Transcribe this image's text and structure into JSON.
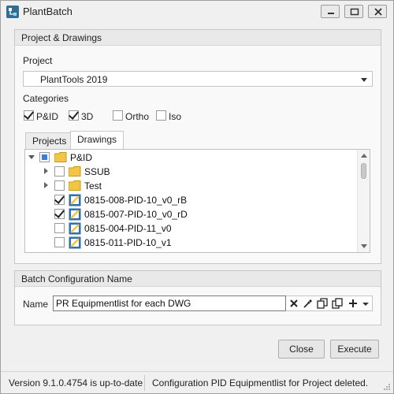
{
  "window": {
    "title": "PlantBatch"
  },
  "project_drawings": {
    "header": "Project & Drawings",
    "project_label": "Project",
    "project_value": "PlantTools 2019",
    "categories_label": "Categories",
    "categories": [
      {
        "label": "P&ID",
        "checked": true
      },
      {
        "label": "3D",
        "checked": true
      },
      {
        "label": "Ortho",
        "checked": false
      },
      {
        "label": "Iso",
        "checked": false
      }
    ],
    "tabs": [
      {
        "label": "Projects",
        "active": false
      },
      {
        "label": "Drawings",
        "active": true
      }
    ],
    "tree": [
      {
        "label": "P&ID",
        "level": 0,
        "expander": "expanded",
        "checkbox": "partial",
        "icon": "folder-icon"
      },
      {
        "label": "SSUB",
        "level": 1,
        "expander": "collapsed",
        "checkbox": "unchecked",
        "icon": "folder-icon"
      },
      {
        "label": "Test",
        "level": 1,
        "expander": "collapsed",
        "checkbox": "unchecked",
        "icon": "folder-icon"
      },
      {
        "label": "0815-008-PID-10_v0_rB",
        "level": 1,
        "expander": "none",
        "checkbox": "checked",
        "icon": "drawing-icon"
      },
      {
        "label": "0815-007-PID-10_v0_rD",
        "level": 1,
        "expander": "none",
        "checkbox": "checked",
        "icon": "drawing-icon"
      },
      {
        "label": "0815-004-PID-11_v0",
        "level": 1,
        "expander": "none",
        "checkbox": "unchecked",
        "icon": "drawing-icon"
      },
      {
        "label": "0815-011-PID-10_v1",
        "level": 1,
        "expander": "none",
        "checkbox": "unchecked",
        "icon": "drawing-icon"
      }
    ]
  },
  "batch_config": {
    "header": "Batch Configuration Name",
    "name_label": "Name",
    "name_value": "PR Equipmentlist for each DWG"
  },
  "buttons": {
    "close": "Close",
    "execute": "Execute"
  },
  "status": {
    "version": "Version 9.1.0.4754 is up-to-date",
    "message": "Configuration PID Equipmentlist for Project deleted."
  },
  "colors": {
    "accent": "#3b7dd8",
    "folder": "#f4c542",
    "drawing_icon": "#2f6fb0"
  }
}
